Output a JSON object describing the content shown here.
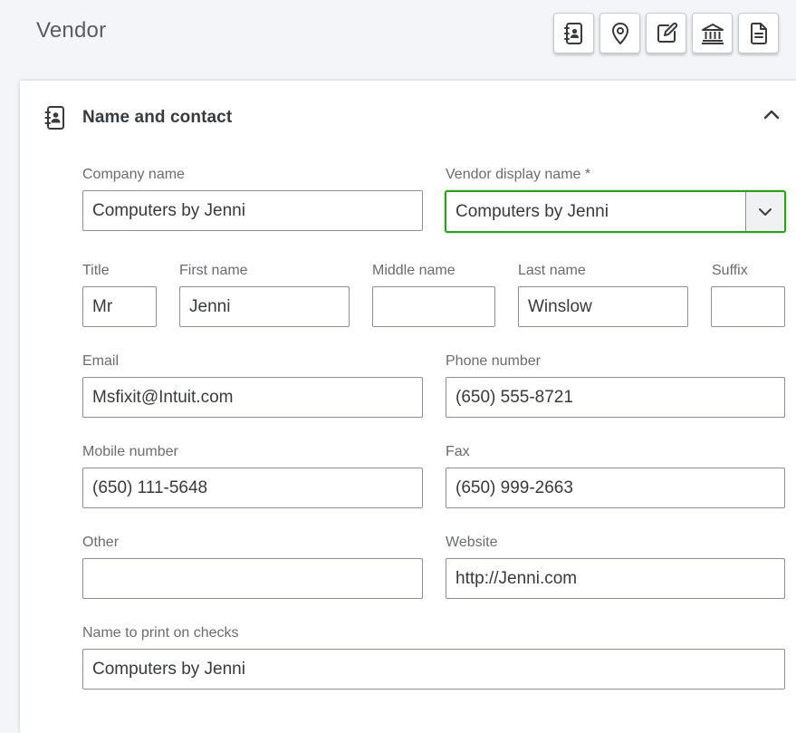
{
  "page": {
    "title": "Vendor"
  },
  "toolbar": {
    "buttons": [
      {
        "icon": "contact-book-icon"
      },
      {
        "icon": "map-pin-icon"
      },
      {
        "icon": "edit-note-icon"
      },
      {
        "icon": "bank-icon"
      },
      {
        "icon": "document-icon"
      }
    ]
  },
  "section": {
    "title": "Name and contact",
    "icon": "contact-book-icon",
    "collapse_icon": "chevron-up-icon"
  },
  "fields": {
    "company_name": {
      "label": "Company name",
      "value": "Computers by Jenni"
    },
    "display_name": {
      "label": "Vendor display name *",
      "value": "Computers by Jenni"
    },
    "title": {
      "label": "Title",
      "value": "Mr"
    },
    "first_name": {
      "label": "First name",
      "value": "Jenni"
    },
    "middle_name": {
      "label": "Middle name",
      "value": ""
    },
    "last_name": {
      "label": "Last name",
      "value": "Winslow"
    },
    "suffix": {
      "label": "Suffix",
      "value": ""
    },
    "email": {
      "label": "Email",
      "value": "Msfixit@Intuit.com"
    },
    "phone": {
      "label": "Phone number",
      "value": "(650) 555-8721"
    },
    "mobile": {
      "label": "Mobile number",
      "value": "(650) 111-5648"
    },
    "fax": {
      "label": "Fax",
      "value": "(650) 999-2663"
    },
    "other": {
      "label": "Other",
      "value": ""
    },
    "website": {
      "label": "Website",
      "value": "http://Jenni.com"
    },
    "print_name": {
      "label": "Name to print on checks",
      "value": "Computers by Jenni"
    }
  },
  "colors": {
    "accent": "#2ca01c",
    "text": "#393a3d",
    "label": "#6b6c72",
    "border": "#8d9096"
  }
}
